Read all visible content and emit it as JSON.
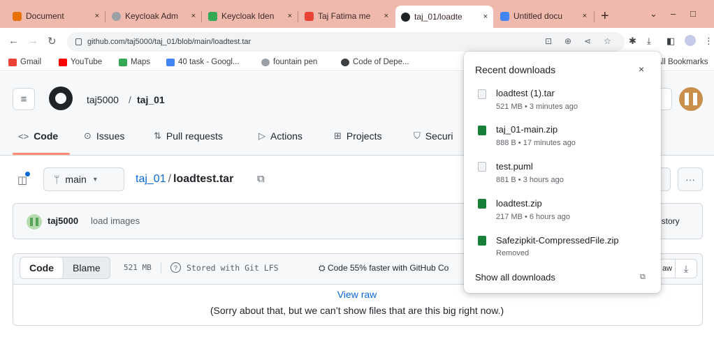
{
  "browser": {
    "tabs": [
      {
        "title": "Document",
        "favicon_color": "#e8710a"
      },
      {
        "title": "Keycloak Adm",
        "favicon_color": "#9aa0a6"
      },
      {
        "title": "Keycloak Iden",
        "favicon_color": "#34a853"
      },
      {
        "title": "Taj Fatima me",
        "favicon_color": "#ea4335"
      },
      {
        "title": "taj_01/loadte",
        "favicon_color": "#1f2328"
      },
      {
        "title": "Untitled docu",
        "favicon_color": "#4285f4"
      }
    ],
    "active_tab": 4,
    "tab_close": "×",
    "new_tab": "+",
    "url": "github.com/taj5000/taj_01/blob/main/loadtest.tar",
    "bookmarks": [
      {
        "label": "Gmail",
        "icon_color": "#ea4335"
      },
      {
        "label": "YouTube",
        "icon_color": "#ff0000"
      },
      {
        "label": "Maps",
        "icon_color": "#34a853"
      },
      {
        "label": "40 task - Googl...",
        "icon_color": "#4285f4"
      },
      {
        "label": "fountain pen",
        "icon_color": "#9aa0a6"
      },
      {
        "label": "Code of Depe...",
        "icon_color": "#3c4043"
      }
    ],
    "all_bookmarks": "All Bookmarks"
  },
  "github": {
    "owner": "taj5000",
    "separator": "/",
    "repo": "taj_01",
    "nav": [
      {
        "label": "Code",
        "icon": "<>"
      },
      {
        "label": "Issues",
        "icon": "⊙"
      },
      {
        "label": "Pull requests",
        "icon": "⇅"
      },
      {
        "label": "Actions",
        "icon": "▷"
      },
      {
        "label": "Projects",
        "icon": "⊞"
      },
      {
        "label": "Securi",
        "icon": "⛉"
      }
    ],
    "branch": "main",
    "file_path": {
      "repo": "taj_01",
      "sep": "/",
      "file": "loadtest.tar"
    },
    "commit": {
      "author": "taj5000",
      "message": "load images",
      "history": "istory"
    },
    "viewer": {
      "code_tab": "Code",
      "blame_tab": "Blame",
      "size": "521 MB",
      "lfs": "Stored with Git LFS",
      "copilot": "Code 55% faster with GitHub Co",
      "raw": "aw",
      "view_raw": "View raw",
      "too_big": "(Sorry about that, but we can’t show files that are this big right now.)"
    }
  },
  "downloads": {
    "title": "Recent downloads",
    "close": "×",
    "items": [
      {
        "name": "loadtest (1).tar",
        "meta": "521 MB • 3 minutes ago",
        "icon_color": "#dadce0"
      },
      {
        "name": "taj_01-main.zip",
        "meta": "888 B • 17 minutes ago",
        "icon_color": "#188038"
      },
      {
        "name": "test.puml",
        "meta": "881 B • 3 hours ago",
        "icon_color": "#dadce0"
      },
      {
        "name": "loadtest.zip",
        "meta": "217 MB • 6 hours ago",
        "icon_color": "#188038"
      },
      {
        "name": "Safezipkit-CompressedFile.zip",
        "meta": "Removed",
        "icon_color": "#188038"
      }
    ],
    "show_all": "Show all downloads"
  }
}
